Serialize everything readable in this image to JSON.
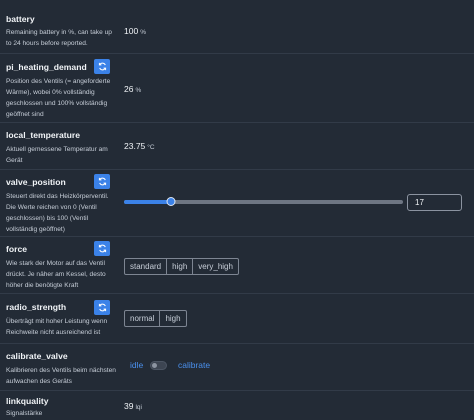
{
  "rows": {
    "battery": {
      "title": "battery",
      "description": "Remaining battery in %, can take up to 24 hours before reported.",
      "value": "100",
      "unit": "%"
    },
    "pi_heating_demand": {
      "title": "pi_heating_demand",
      "description": "Position des Ventils (= angeforderte Wärme), wobei 0% vollständig geschlossen und 100% vollständig geöffnet sind",
      "value": "26",
      "unit": "%"
    },
    "local_temperature": {
      "title": "local_temperature",
      "description": "Aktuell gemessene Temperatur am Gerät",
      "value": "23.75",
      "unit": "°C"
    },
    "valve_position": {
      "title": "valve_position",
      "description": "Steuert direkt das Heizkörperventil. Die Werte reichen von 0 (Ventil geschlossen) bis 100 (Ventil vollständig geöffnet)",
      "slider_min": 0,
      "slider_max": 100,
      "slider_value": 17,
      "input_value": "17"
    },
    "force": {
      "title": "force",
      "description": "Wie stark der Motor auf das Ventil drückt. Je näher am Kessel, desto höher die benötigte Kraft",
      "options": [
        "standard",
        "high",
        "very_high"
      ]
    },
    "radio_strength": {
      "title": "radio_strength",
      "description": "Überträgt mit hoher Leistung wenn Reichweite nicht ausreichend ist",
      "options": [
        "normal",
        "high"
      ]
    },
    "calibrate_valve": {
      "title": "calibrate_valve",
      "description": "Kalibrieren des Ventils beim nächsten aufwachen des Geräts",
      "off_label": "idle",
      "on_label": "calibrate",
      "toggle_on": false
    },
    "linkquality": {
      "title": "linkquality",
      "description": "Signalstärke",
      "value": "39",
      "unit": "lqi"
    }
  },
  "icons": {
    "refresh": "refresh-icon"
  },
  "colors": {
    "background": "#232b36",
    "accent": "#3b82e8",
    "link": "#4a90ee",
    "divider": "#323b48"
  }
}
